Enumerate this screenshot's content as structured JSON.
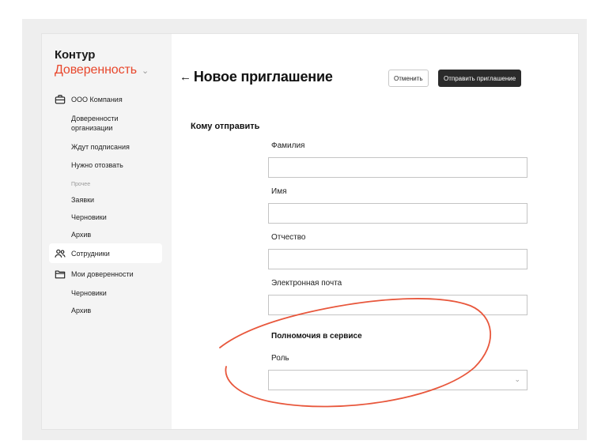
{
  "brand": {
    "name": "Контур",
    "product": "Доверенность"
  },
  "sidebar": {
    "company": "ООО Компания",
    "company_items": [
      "Доверенности организации",
      "Ждут подписания",
      "Нужно отозвать"
    ],
    "other_heading": "Прочее",
    "other_items": [
      "Заявки",
      "Черновики",
      "Архив"
    ],
    "employees": "Сотрудники",
    "my_poa": "Мои доверенности",
    "my_items": [
      "Черновики",
      "Архив"
    ]
  },
  "header": {
    "title": "Новое приглашение",
    "cancel_label": "Отменить",
    "send_label": "Отправить приглашение"
  },
  "form": {
    "section_title": "Кому отправить",
    "fields": [
      {
        "label": "Фамилия",
        "value": ""
      },
      {
        "label": "Имя",
        "value": ""
      },
      {
        "label": "Отчество",
        "value": ""
      },
      {
        "label": "Электронная почта",
        "value": ""
      }
    ],
    "permissions_title": "Полномочия в сервисе",
    "role": {
      "label": "Роль",
      "value": ""
    }
  },
  "colors": {
    "accent": "#e8472c",
    "annotation": "#e8573c",
    "primary_button": "#2b2b2b"
  }
}
